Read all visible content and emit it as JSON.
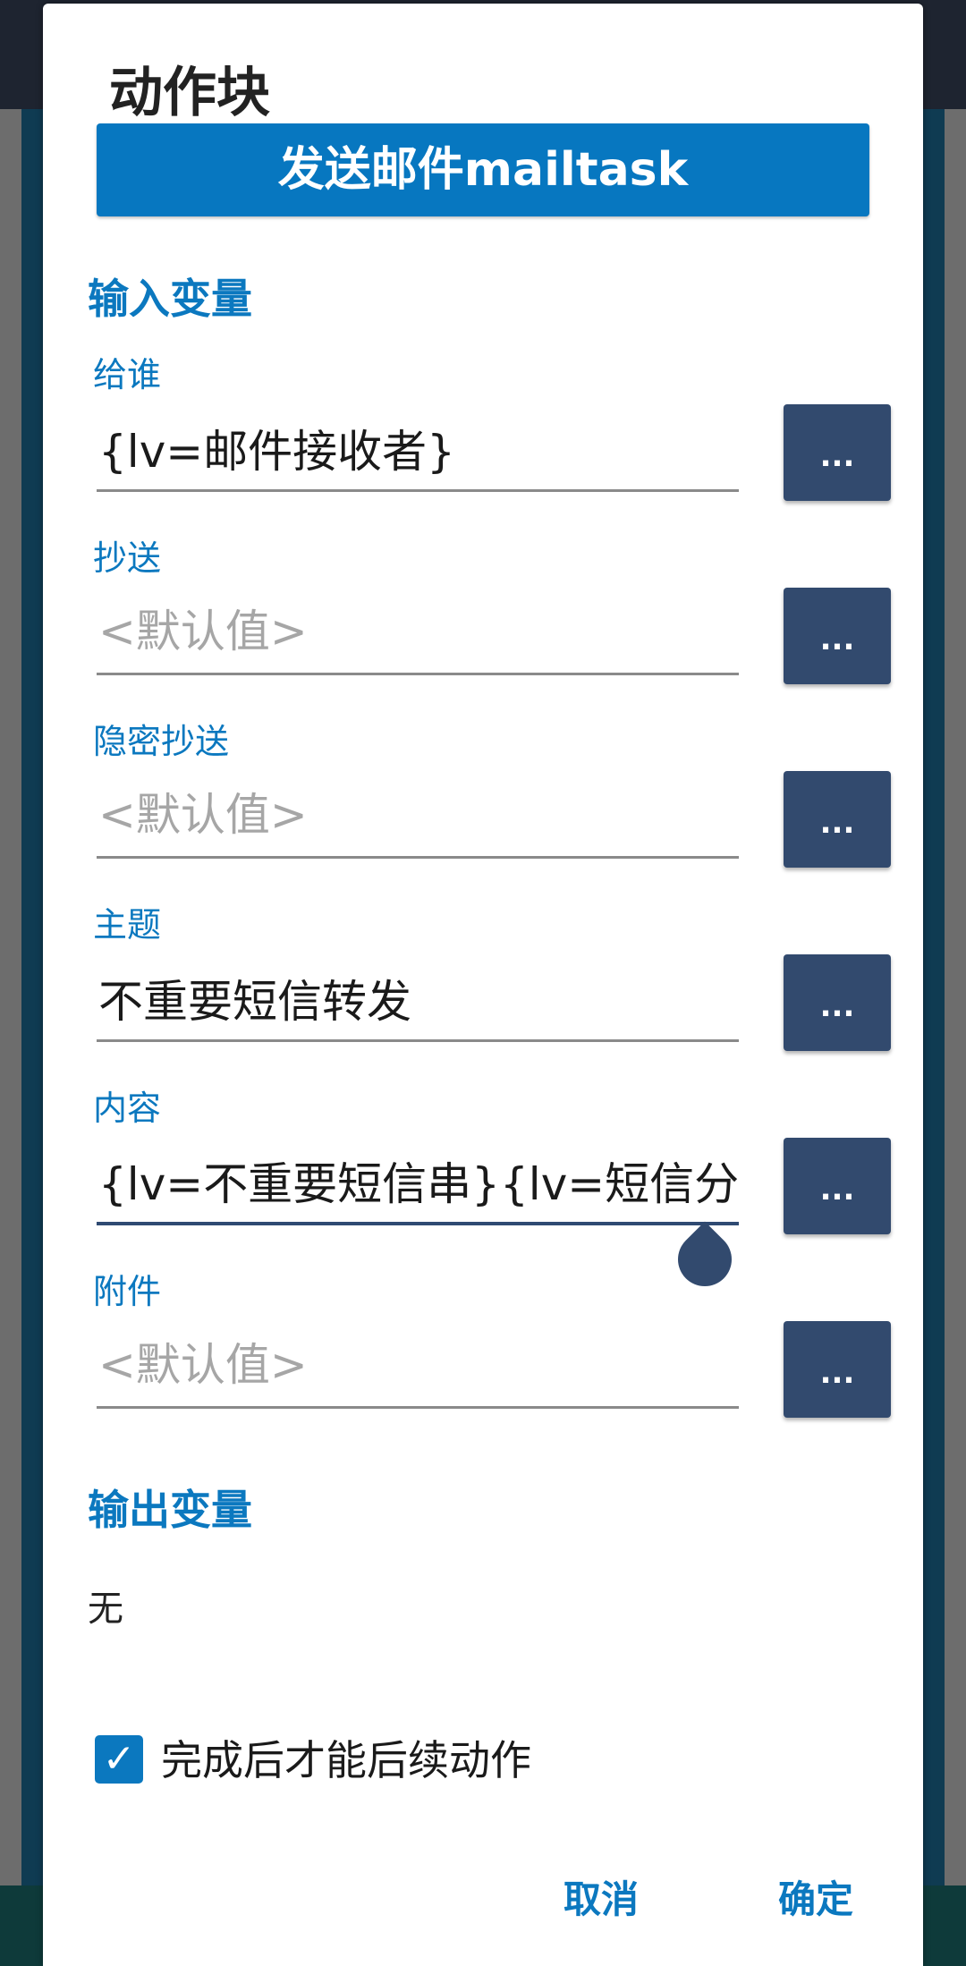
{
  "dialog": {
    "title": "动作块",
    "action_name": "发送邮件mailtask"
  },
  "input_section": {
    "title": "输入变量",
    "fields": [
      {
        "label": "给谁",
        "value": "{lv=邮件接收者}",
        "placeholder": "<默认值>",
        "button": "..."
      },
      {
        "label": "抄送",
        "value": "",
        "placeholder": "<默认值>",
        "button": "..."
      },
      {
        "label": "隐密抄送",
        "value": "",
        "placeholder": "<默认值>",
        "button": "..."
      },
      {
        "label": "主题",
        "value": "不重要短信转发",
        "placeholder": "<默认值>",
        "button": "..."
      },
      {
        "label": "内容",
        "value": "{lv=不重要短信串}{lv=短信分割",
        "placeholder": "<默认值>",
        "button": "..."
      },
      {
        "label": "附件",
        "value": "",
        "placeholder": "<默认值>",
        "button": "..."
      }
    ]
  },
  "output_section": {
    "title": "输出变量",
    "value": "无"
  },
  "options": {
    "wait_checkbox": {
      "label": "完成后才能后续动作",
      "checked": true,
      "mark": "✓"
    }
  },
  "buttons": {
    "cancel": "取消",
    "ok": "确定"
  },
  "colors": {
    "accent": "#0b78bf",
    "banner": "#0777c0",
    "button": "#324a6e"
  }
}
